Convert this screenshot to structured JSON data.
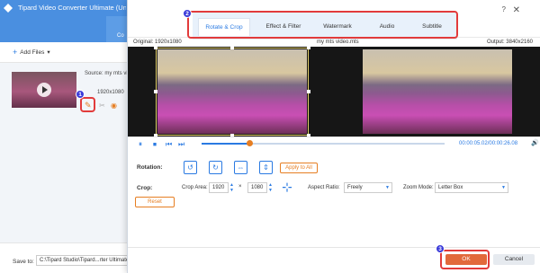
{
  "background_app": {
    "title": "Tipard Video Converter Ultimate (Unregisteredd",
    "convert_tab_label": "Co",
    "add_files_label": "Add Files",
    "source_label": "Source: my mts vi",
    "resolution_short": "1920x1080",
    "save_to_label": "Save to:",
    "save_path": "C:\\Tipard Studio\\Tipard...rter Ultimate\\C"
  },
  "callouts": [
    "1",
    "2",
    "3"
  ],
  "dialog": {
    "tabs": [
      {
        "label": "Rotate & Crop"
      },
      {
        "label": "Effect & Filter"
      },
      {
        "label": "Watermark"
      },
      {
        "label": "Audio"
      },
      {
        "label": "Subtitle"
      }
    ],
    "original_label": "Original: 1920x1080",
    "file_name": "my mts video.mts",
    "output_label": "Output: 3840x2160",
    "timecode": "00:00:05.02/00:00:26.08",
    "rotation_label": "Rotation:",
    "apply_to_all_label": "Apply to All",
    "crop_label": "Crop:",
    "crop_area_label": "Crop Area:",
    "crop_width": "1920",
    "crop_height": "1080",
    "aspect_ratio_label": "Aspect Ratio:",
    "aspect_ratio_value": "Freely",
    "zoom_mode_label": "Zoom Mode:",
    "zoom_mode_value": "Letter Box",
    "reset_label": "Reset",
    "ok_label": "OK",
    "cancel_label": "Cancel",
    "playback_progress": 0.19
  },
  "colors": {
    "accent": "#2a7ae2",
    "orange": "#e67e22",
    "callout_red": "#e23b3b",
    "callout_blue": "#3b3bd9"
  }
}
